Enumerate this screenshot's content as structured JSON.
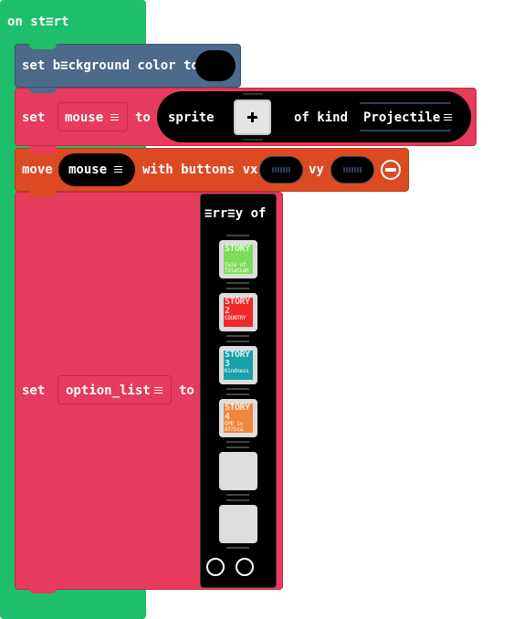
{
  "hat": {
    "label": "on st≡rt"
  },
  "set_background": {
    "label": "set b≡ckground color to"
  },
  "set_mouse": {
    "set": "set",
    "variable": "mouse",
    "to": "to",
    "sprite": "sprite",
    "of_kind": "of kind",
    "kind": "Projectile"
  },
  "move": {
    "label": "move",
    "sprite": "mouse",
    "with_buttons": "with buttons vx",
    "vy": "vy"
  },
  "set_option_list": {
    "set": "set",
    "variable": "option_list",
    "to": "to",
    "array_label": "≡rr≡y of",
    "images": [
      {
        "title": "STORY",
        "subtitle": "Tale of Tolatcah",
        "color": "#7ddc5a"
      },
      {
        "title": "STORY 2",
        "subtitle": "COUNTRY",
        "color": "#ee2a2a"
      },
      {
        "title": "STORY 3",
        "subtitle": "Kindness",
        "color": "#1aa0a8"
      },
      {
        "title": "STORY 4",
        "subtitle": "GPE in Africa",
        "color": "#f0873a"
      },
      {
        "title": "",
        "subtitle": "",
        "color": "#dddddd"
      },
      {
        "title": "",
        "subtitle": "",
        "color": "#dddddd"
      }
    ]
  },
  "colors": {
    "hat": "#1ebe6a",
    "scene": "#4c6b8a",
    "sprites": "#e63b5c",
    "controller": "#dc4a24",
    "array": "#000000"
  }
}
